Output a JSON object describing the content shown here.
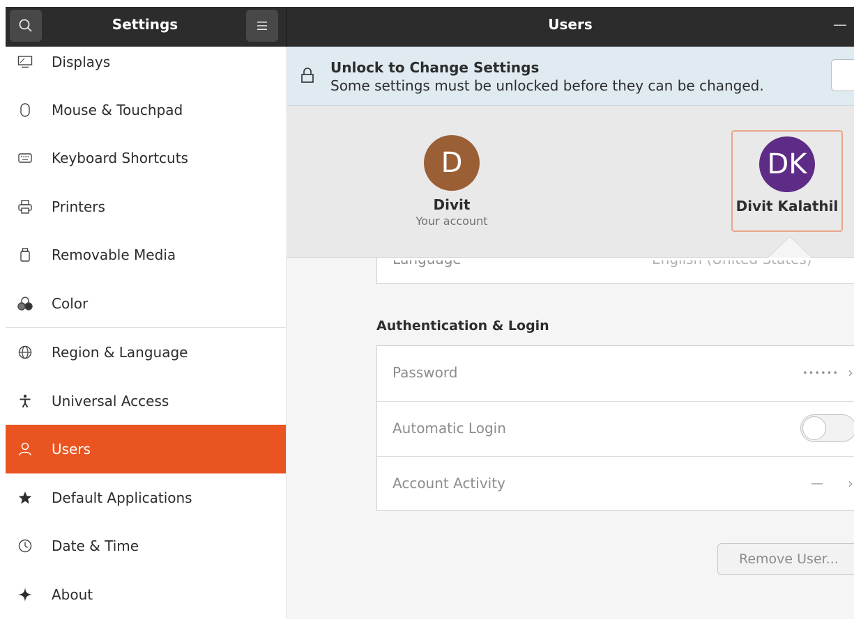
{
  "header": {
    "sidebar_title": "Settings",
    "page_title": "Users",
    "minimize_glyph": "—"
  },
  "sidebar": {
    "items": [
      {
        "label": "Displays",
        "icon": "display-icon"
      },
      {
        "label": "Mouse & Touchpad",
        "icon": "mouse-icon"
      },
      {
        "label": "Keyboard Shortcuts",
        "icon": "keyboard-icon"
      },
      {
        "label": "Printers",
        "icon": "printer-icon"
      },
      {
        "label": "Removable Media",
        "icon": "removable-media-icon"
      },
      {
        "label": "Color",
        "icon": "color-icon"
      },
      {
        "label": "Region & Language",
        "icon": "globe-icon"
      },
      {
        "label": "Universal Access",
        "icon": "accessibility-icon"
      },
      {
        "label": "Users",
        "icon": "user-icon",
        "active": true
      },
      {
        "label": "Default Applications",
        "icon": "star-icon"
      },
      {
        "label": "Date & Time",
        "icon": "clock-icon"
      },
      {
        "label": "About",
        "icon": "sparkle-icon"
      }
    ],
    "accent_color": "#e95420"
  },
  "infobar": {
    "title": "Unlock to Change Settings",
    "message": "Some settings must be unlocked before they can be changed."
  },
  "users": [
    {
      "initials": "D",
      "name": "Divit",
      "subtitle": "Your account",
      "avatar_color": "#9b5f36"
    },
    {
      "initials": "DK",
      "name": "Divit Kalathil",
      "subtitle": "",
      "avatar_color": "#5e2b86",
      "selected": true
    }
  ],
  "language_row": {
    "label": "Language",
    "value": "English (United States)"
  },
  "auth": {
    "section_title": "Authentication & Login",
    "rows": [
      {
        "label": "Password",
        "value": "••••••"
      },
      {
        "label": "Automatic Login",
        "toggle": false
      },
      {
        "label": "Account Activity",
        "value": "—"
      }
    ]
  },
  "remove_button": "Remove User..."
}
